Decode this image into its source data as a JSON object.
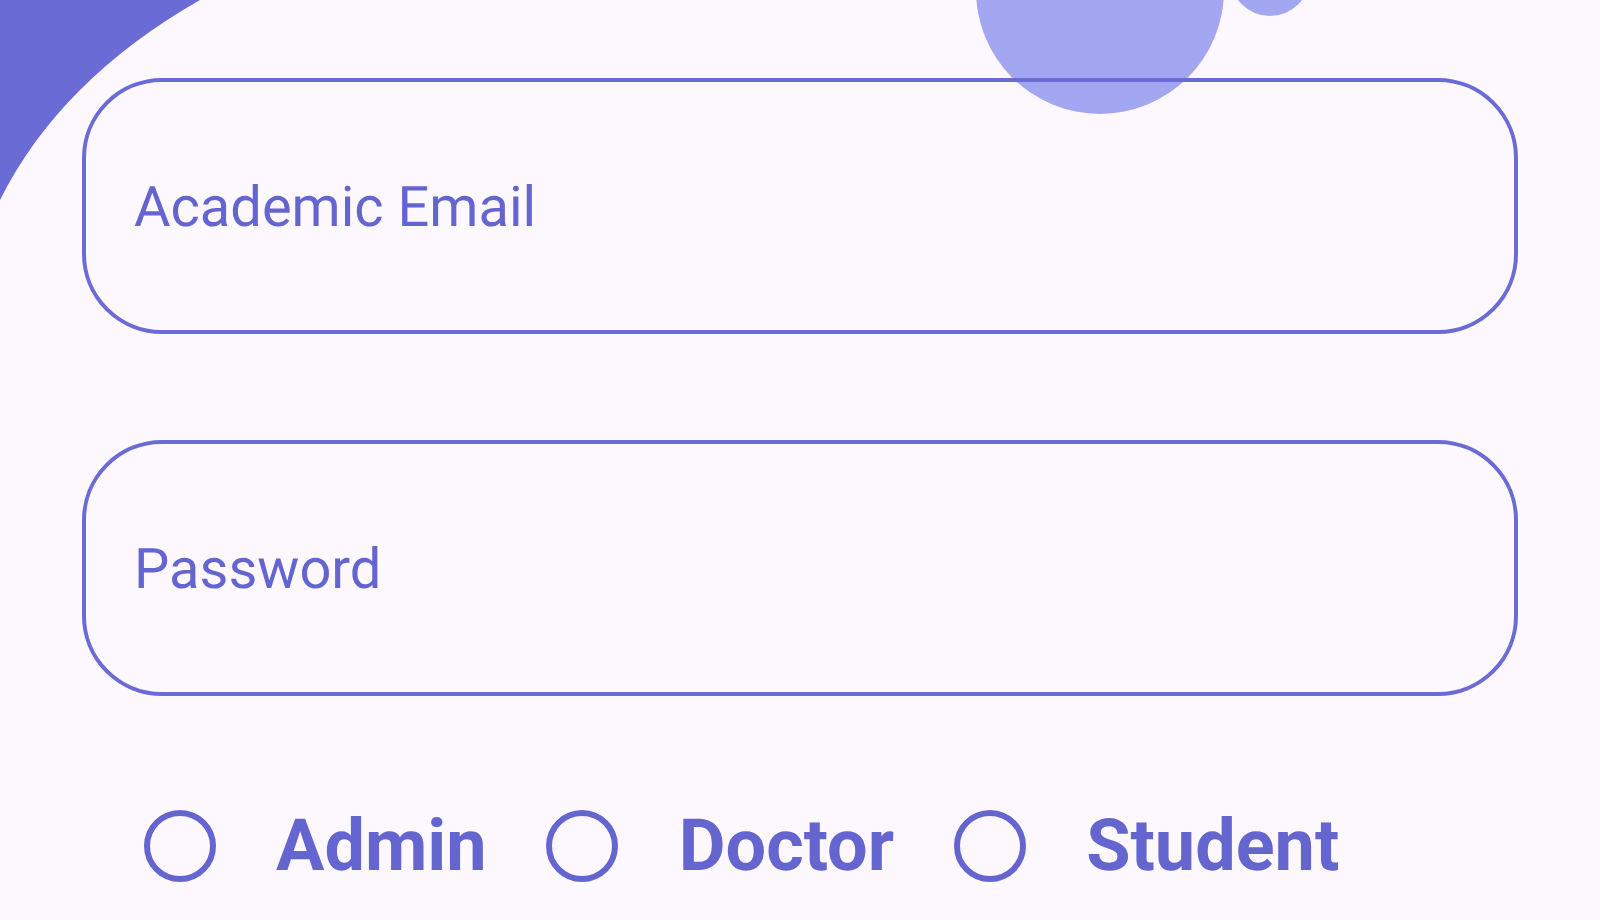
{
  "fields": [
    {
      "placeholder": "Academic Email"
    },
    {
      "placeholder": "Password"
    }
  ],
  "roles": [
    {
      "label": "Admin",
      "selected": false
    },
    {
      "label": "Doctor",
      "selected": false
    },
    {
      "label": "Student",
      "selected": false
    }
  ]
}
